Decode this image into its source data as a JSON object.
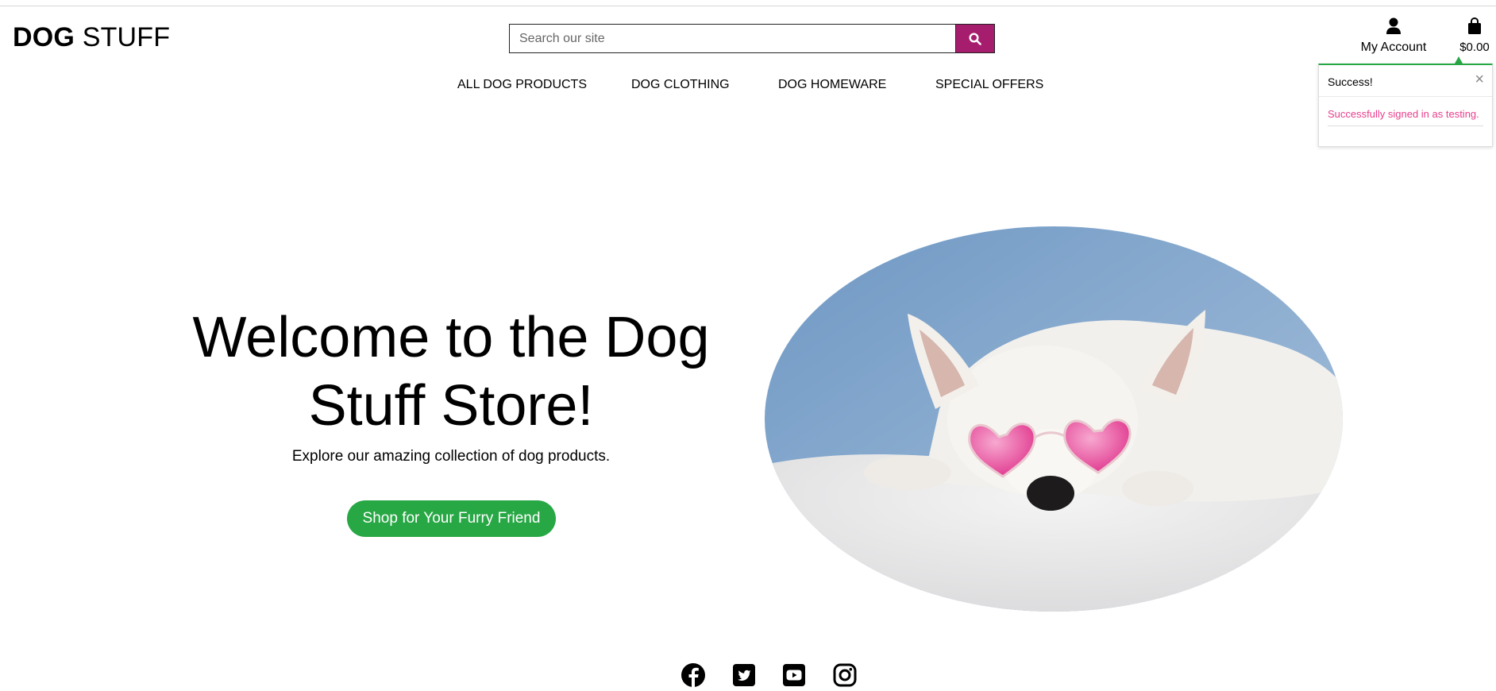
{
  "header": {
    "logo_bold": "DOG",
    "logo_light": "STUFF",
    "search_placeholder": "Search our site",
    "search_icon": "search-icon",
    "account_label": "My Account",
    "account_icon": "user-icon",
    "bag_label": "$0.00",
    "bag_icon": "shopping-bag-icon"
  },
  "nav": {
    "items": [
      "ALL DOG PRODUCTS",
      "DOG CLOTHING",
      "DOG HOMEWARE",
      "SPECIAL OFFERS"
    ]
  },
  "toast": {
    "title": "Success!",
    "close": "×",
    "message": "Successfully signed in as testing."
  },
  "hero": {
    "title_line1": "Welcome to the Dog",
    "title_line2": "Stuff Store!",
    "subtitle": "Explore our amazing collection of dog products.",
    "cta": "Shop for Your Furry Friend"
  },
  "social": {
    "icons": [
      "facebook-icon",
      "twitter-icon",
      "youtube-icon",
      "instagram-icon"
    ]
  },
  "colors": {
    "brand": "#a71d6e",
    "success": "#28a745",
    "toast_message": "#e83e8c"
  }
}
